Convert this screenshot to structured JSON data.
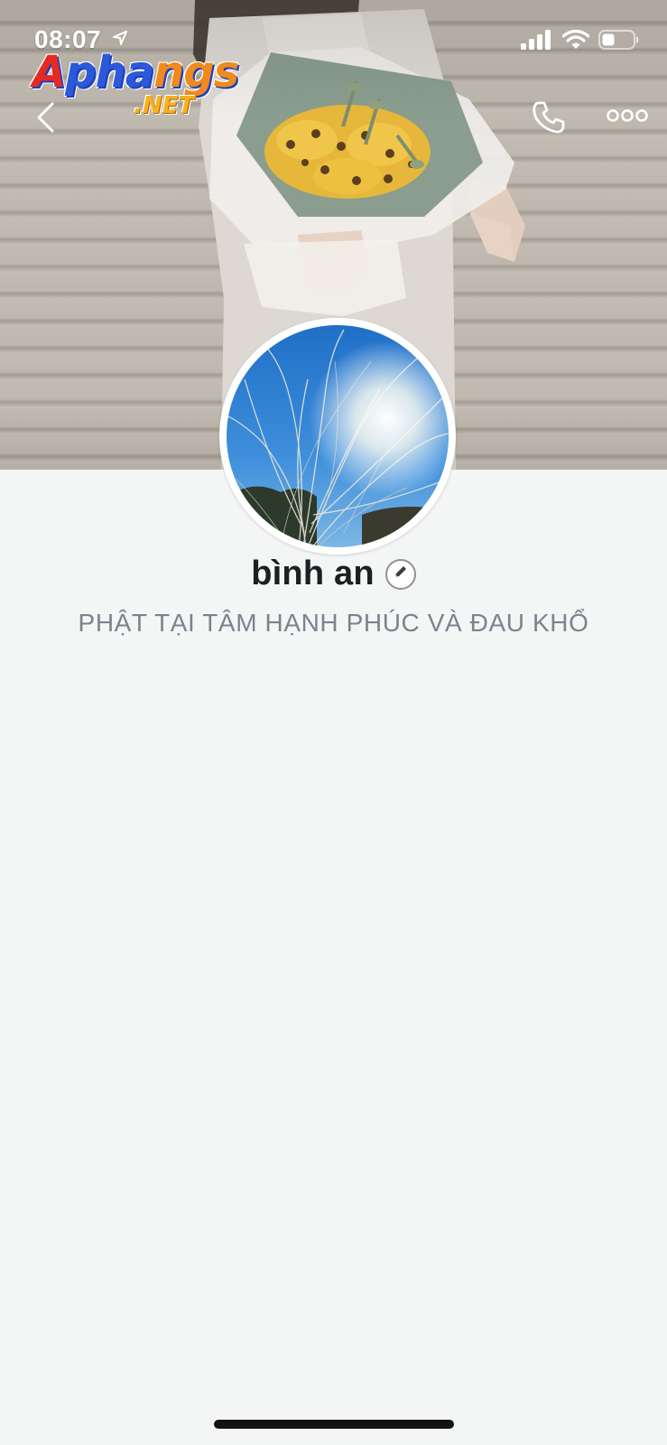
{
  "status_bar": {
    "time": "08:07",
    "icons": [
      "location-arrow-icon",
      "signal-icon",
      "wifi-icon",
      "battery-icon"
    ]
  },
  "watermark": {
    "brand": "Aphangs",
    "brand_parts": [
      "A",
      "pha",
      "ngs"
    ],
    "suffix": ".NET"
  },
  "nav": {
    "back_icon": "chevron-left-icon",
    "call_icon": "phone-icon",
    "more_icon": "more-dots-icon"
  },
  "profile": {
    "name": "bình an",
    "bio": "PHẬT TẠI TÂM HẠNH PHÚC VÀ ĐAU KHỔ",
    "edit_icon": "pencil-icon"
  },
  "colors": {
    "background": "#f4f5f5",
    "name": "#1d1f22",
    "bio": "#7c838c",
    "home_indicator": "#121212"
  }
}
